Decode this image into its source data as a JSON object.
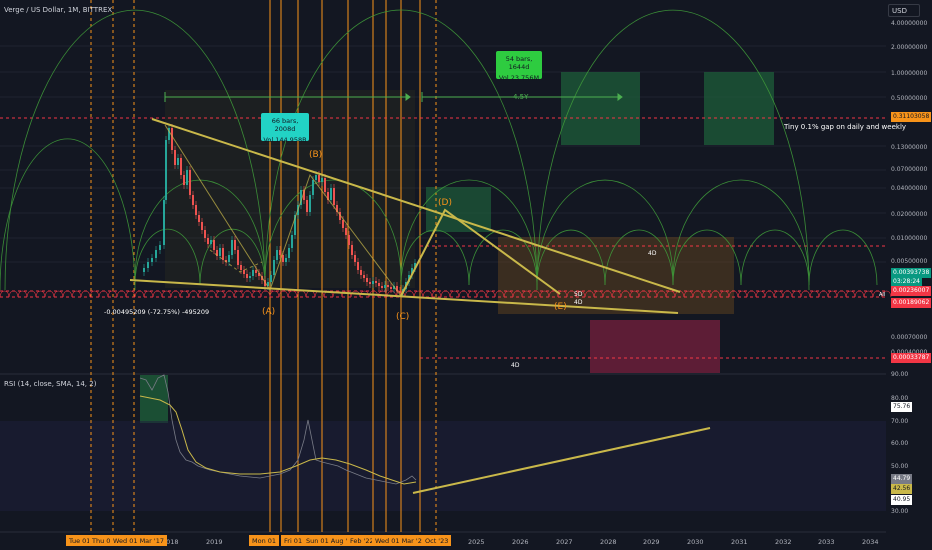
{
  "header": {
    "title": "Verge / US Dollar, 1M, BITTREX"
  },
  "currency_button": "USD",
  "price_axis": [
    "4.00000000",
    "2.00000000",
    "1.00000000",
    "0.50000000",
    "0.13000000",
    "0.07000000",
    "0.04000000",
    "0.02000000",
    "0.01000000",
    "0.00500000",
    "0.00070000",
    "0.00040000"
  ],
  "price_tags": [
    {
      "label": "0.31103058",
      "color": "#f7931a"
    },
    {
      "label": "0.00393738",
      "color": "#089981"
    },
    {
      "label": "03:28:24",
      "color": "#089981"
    },
    {
      "label": "0.00236007",
      "color": "#f23645"
    },
    {
      "label": "0.00189062",
      "color": "#f23645"
    },
    {
      "label": "0.00033787",
      "color": "#f23645"
    }
  ],
  "rsi": {
    "label": "RSI (14, close, SMA, 14, 2)",
    "axis": [
      "90.00",
      "80.00",
      "70.00",
      "60.00",
      "50.00",
      "30.00"
    ],
    "tags": [
      {
        "label": "75.76",
        "color": "#ffffff"
      },
      {
        "label": "44.79",
        "color": "#787b86"
      },
      {
        "label": "42.56",
        "color": "#c9b84a"
      },
      {
        "label": "40.95",
        "color": "#ffffff"
      }
    ]
  },
  "time_axis": [
    "2018",
    "2019",
    "2025",
    "2026",
    "2027",
    "2028",
    "2029",
    "2030",
    "2031",
    "2032",
    "2033",
    "2034"
  ],
  "time_tags": [
    "Tue 01",
    "Thu 0",
    "Wed 01 Mar '17",
    "Mon 01",
    "Fri 01",
    "Sun 01 Aug '21",
    "Feb '22",
    "Wed 01 Mar '23",
    "Oct '23"
  ],
  "annotations": {
    "range_box_1": {
      "line1": "66 bars, 2008d",
      "line2": "Vol 144.958B"
    },
    "range_box_2": {
      "line1": "54 bars, 1644d",
      "line2": "Vol 23.756M"
    },
    "distance_label": "4.5Y",
    "gap_note": "Tiny 0.1% gap on daily and weekly",
    "drop_label": "-0.00495209 (-72.75%) -495209",
    "wave_A": "(A)",
    "wave_B": "(B)",
    "wave_C": "(C)",
    "wave_D": "(D)",
    "wave_E": "(E)",
    "label_4d_1": "4D",
    "label_4d_2": "4D",
    "label_4d_3": "4D",
    "label_5d": "5D",
    "label_all": "All"
  },
  "colors": {
    "bg": "#131722",
    "up": "#26a69a",
    "down": "#ef5350",
    "accent": "#f7931a",
    "trend": "#c9b84a",
    "green_box": "#2e7d4f",
    "red_box": "#6b1f3a"
  }
}
